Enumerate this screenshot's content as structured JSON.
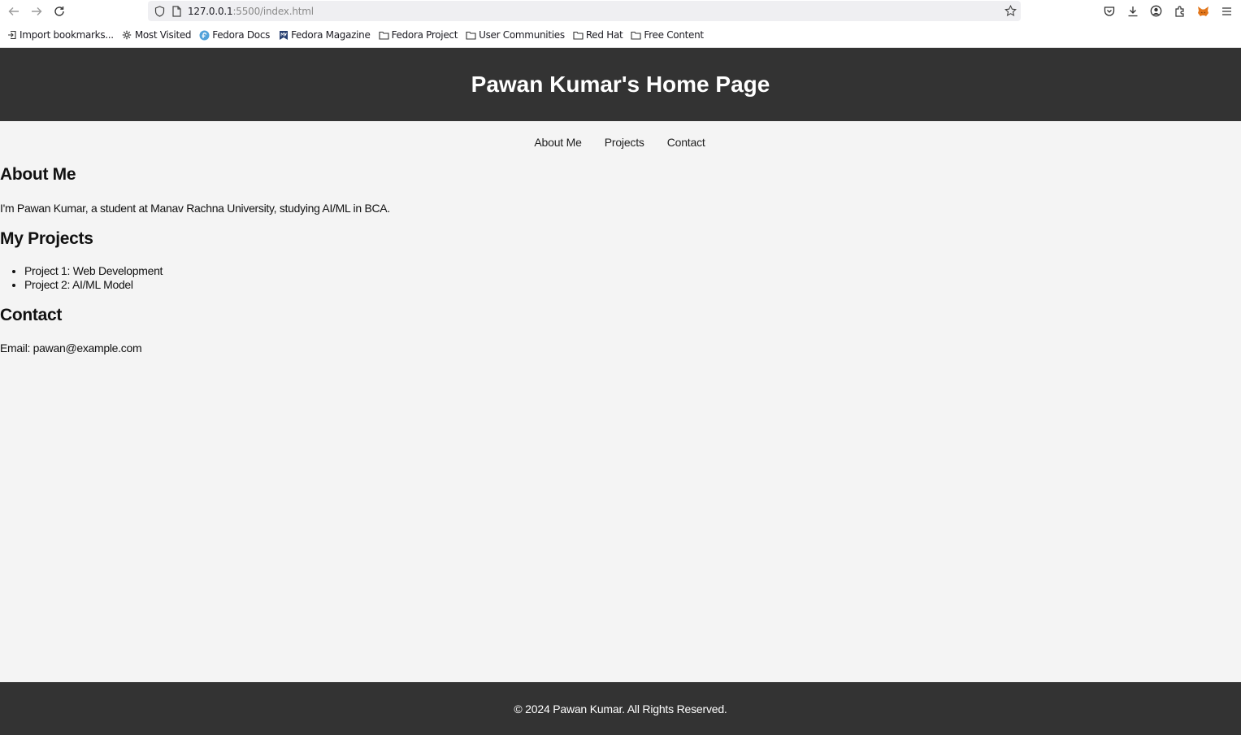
{
  "browser": {
    "url_host": "127.0.0.1",
    "url_rest": ":5500/index.html",
    "bookmarks": [
      {
        "label": "Import bookmarks...",
        "icon": "import-icon"
      },
      {
        "label": "Most Visited",
        "icon": "gear-icon"
      },
      {
        "label": "Fedora Docs",
        "icon": "fedora-icon"
      },
      {
        "label": "Fedora Magazine",
        "icon": "magazine-icon"
      },
      {
        "label": "Fedora Project",
        "icon": "folder-icon"
      },
      {
        "label": "User Communities",
        "icon": "folder-icon"
      },
      {
        "label": "Red Hat",
        "icon": "folder-icon"
      },
      {
        "label": "Free Content",
        "icon": "folder-icon"
      }
    ]
  },
  "page": {
    "title": "Pawan Kumar's Home Page",
    "nav": [
      "About Me",
      "Projects",
      "Contact"
    ],
    "about": {
      "heading": "About Me",
      "text": "I'm Pawan Kumar, a student at Manav Rachna University, studying AI/ML in BCA."
    },
    "projects": {
      "heading": "My Projects",
      "items": [
        "Project 1: Web Development",
        "Project 2: AI/ML Model"
      ]
    },
    "contact": {
      "heading": "Contact",
      "text": "Email: pawan@example.com"
    },
    "footer": "© 2024 Pawan Kumar. All Rights Reserved."
  },
  "colors": {
    "header_bg": "#333333",
    "page_bg": "#f4f4f4",
    "metamask": "#e2761b"
  }
}
